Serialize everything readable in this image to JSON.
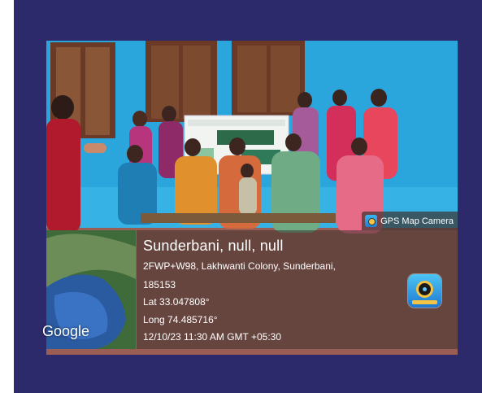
{
  "app_badge": {
    "label": "GPS Map Camera",
    "icon": "gps-camera-icon"
  },
  "map": {
    "brand": "Google"
  },
  "location": {
    "place": "Sunderbani, null, null",
    "address_line1": "2FWP+W98, Lakhwanti Colony, Sunderbani,",
    "address_line2": "185153",
    "lat": "Lat 33.047808°",
    "long": "Long 74.485716°",
    "datetime": "12/10/23 11:30 AM GMT +05:30"
  },
  "colors": {
    "frame": "#2d2a6c",
    "wall": "#2aa8de",
    "panel": "rgba(60,50,45,0.55)",
    "text": "#ffffff"
  }
}
